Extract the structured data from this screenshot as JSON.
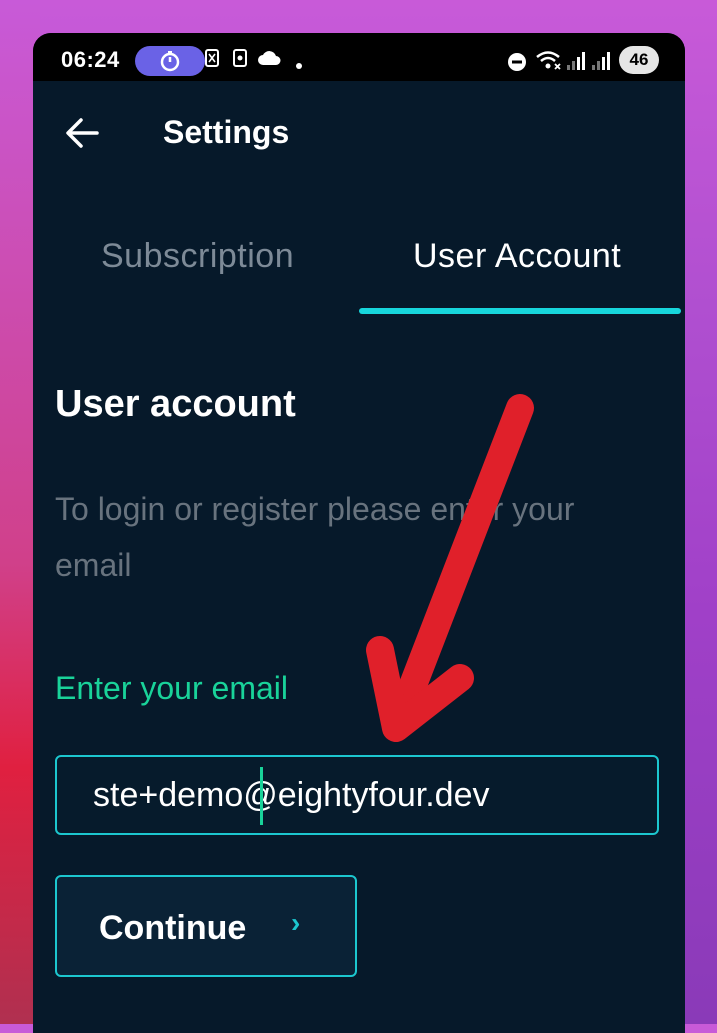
{
  "status_bar": {
    "time": "06:24",
    "battery": "46",
    "icons": [
      "stopwatch-icon",
      "sim-icon",
      "nfc-icon",
      "cloud-icon",
      "dot-icon",
      "dnd-icon",
      "wifi-icon",
      "signal-icon",
      "signal-icon",
      "battery-icon"
    ]
  },
  "app_bar": {
    "title": "Settings",
    "back_icon": "back-arrow-icon"
  },
  "tabs": [
    {
      "label": "Subscription",
      "active": false
    },
    {
      "label": "User Account",
      "active": true
    }
  ],
  "user_account": {
    "title": "User account",
    "description": "To login or register please enter your email",
    "email_label": "Enter your email",
    "email_value": "ste+demo@eightyfour.dev",
    "continue_label": "Continue",
    "continue_icon": "chevron-right-icon"
  },
  "annotation": {
    "icon": "red-arrow-icon",
    "color": "#e0202a"
  },
  "colors": {
    "background": "#06192a",
    "accent_cyan": "#1cc7cf",
    "accent_green": "#19d39a",
    "muted_text": "#68737e"
  }
}
